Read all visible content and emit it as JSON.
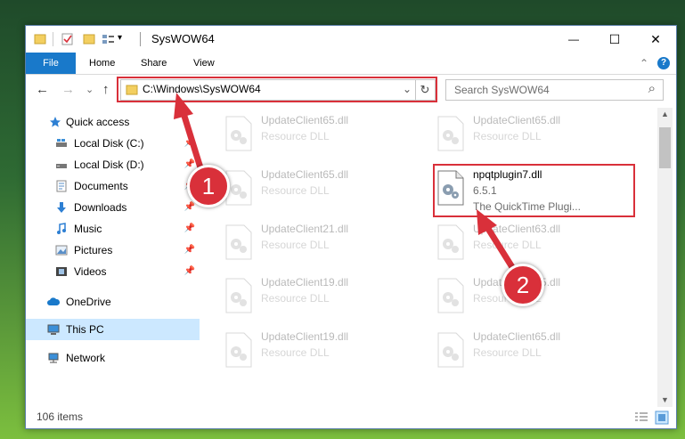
{
  "window": {
    "title": "SysWOW64",
    "minimize": "—",
    "maximize": "☐",
    "close": "✕",
    "help": "?",
    "collapse_ribbon": "⌃",
    "quick_access_dropdown": "▾"
  },
  "ribbon": {
    "tabs": [
      "File",
      "Home",
      "Share",
      "View"
    ]
  },
  "nav": {
    "back": "←",
    "forward": "→",
    "recent": "⌄",
    "up": "↑"
  },
  "address": {
    "path": "C:\\Windows\\SysWOW64",
    "dropdown": "⌄",
    "refresh": "↻"
  },
  "search": {
    "placeholder": "Search SysWOW64",
    "icon": "⌕"
  },
  "sidebar": {
    "items": [
      {
        "label": "Quick access",
        "icon": "star-icon"
      },
      {
        "label": "Local Disk (C:)",
        "icon": "drive-icon"
      },
      {
        "label": "Local Disk (D:)",
        "icon": "drive-icon"
      },
      {
        "label": "Documents",
        "icon": "documents-icon"
      },
      {
        "label": "Downloads",
        "icon": "download-icon"
      },
      {
        "label": "Music",
        "icon": "music-icon"
      },
      {
        "label": "Pictures",
        "icon": "pictures-icon"
      },
      {
        "label": "Videos",
        "icon": "videos-icon"
      },
      {
        "label": "OneDrive",
        "icon": "cloud-icon"
      },
      {
        "label": "This PC",
        "icon": "computer-icon"
      },
      {
        "label": "Network",
        "icon": "network-icon"
      }
    ],
    "pin_glyph": "📌"
  },
  "files": [
    {
      "name": "UpdateClient65.dll",
      "type": "Resource DLL"
    },
    {
      "name": "UpdateClient65.dll",
      "type": "Resource DLL"
    },
    {
      "name": "UpdateClient65.dll",
      "type": "Resource DLL"
    },
    {
      "name": "npqtplugin7.dll",
      "version": "6.5.1",
      "description": "The QuickTime Plugi..."
    },
    {
      "name": "UpdateClient21.dll",
      "type": "Resource DLL"
    },
    {
      "name": "UpdateClient63.dll",
      "type": "Resource DLL"
    },
    {
      "name": "UpdateClient19.dll",
      "type": "Resource DLL"
    },
    {
      "name": "UpdateClient65.dll",
      "type": "Resource DLL"
    },
    {
      "name": "UpdateClient19.dll",
      "type": "Resource DLL"
    },
    {
      "name": "UpdateClient65.dll",
      "type": "Resource DLL"
    }
  ],
  "status": {
    "item_count": "106 items"
  },
  "callouts": [
    "1",
    "2"
  ],
  "colors": {
    "accent": "#1979ca",
    "highlight": "#d9303a",
    "selected": "#cce8ff"
  }
}
